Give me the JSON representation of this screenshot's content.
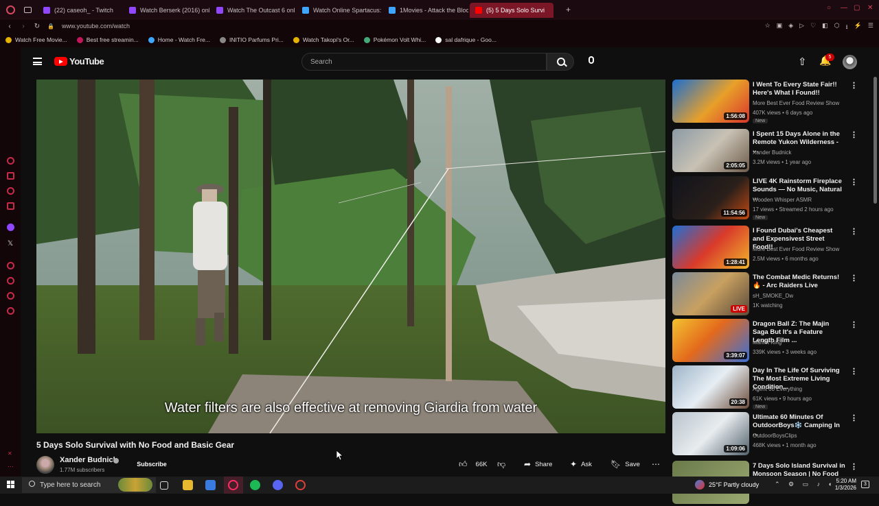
{
  "browser": {
    "tabs": [
      {
        "label": "(22) caseoh_ - Twitch",
        "color": "#9146ff"
      },
      {
        "label": "Watch Berserk (2016) onli",
        "color": "#9146ff"
      },
      {
        "label": "Watch The Outcast 6 onlin",
        "color": "#9146ff"
      },
      {
        "label": "Watch Online Spartacus: I",
        "color": "#3ea6ff"
      },
      {
        "label": "1Movies - Attack the Block",
        "color": "#3ea6ff"
      },
      {
        "label": "(5) 5 Days Solo Survi",
        "color": "#ff0000",
        "active": true
      }
    ],
    "url": "www.youtube.com/watch",
    "bookmarks": [
      {
        "label": "Watch Free Movie...",
        "color": "#e5b200"
      },
      {
        "label": "Best free streamin...",
        "color": "#c2185b"
      },
      {
        "label": "Home - Watch Fre...",
        "color": "#3ea6ff"
      },
      {
        "label": "INITIO Parfums Pri...",
        "color": "#888888"
      },
      {
        "label": "Watch Takopi's Or...",
        "color": "#e5b200"
      },
      {
        "label": "Pokémon Volt Whi...",
        "color": "#4a7"
      },
      {
        "label": "sal dafrique - Goo...",
        "color": "#ffffff"
      }
    ]
  },
  "youtube": {
    "logo": "YouTube",
    "search_placeholder": "Search",
    "notification_count": "5",
    "video": {
      "title": "5 Days Solo Survival with No Food and Basic Gear",
      "subtitle": "Water filters are also effective at removing Giardia from water",
      "channel": "Xander Budnick",
      "subscribers": "1.77M subscribers",
      "subscribe_label": "Subscribe",
      "likes": "66K",
      "share_label": "Share",
      "ask_label": "Ask",
      "save_label": "Save"
    },
    "recommendations": [
      {
        "title": "I Went To Every State Fair!! Here's What I Found!!",
        "channel": "More Best Ever Food Review Show",
        "meta": "407K views • 6 days ago",
        "badge": "New",
        "duration": "1:56:08",
        "thumb": "linear-gradient(135deg,#1b6fd1,#e8a02a 55%,#d8342c)"
      },
      {
        "title": "I Spent 15 Days Alone in the Remote Yukon Wilderness - ...",
        "channel": "Xander Budnick",
        "meta": "3.2M views • 1 year ago",
        "badge": "",
        "duration": "2:05:05",
        "thumb": "linear-gradient(135deg,#8b9aa5,#c8c2b4 50%,#6d5a4a)"
      },
      {
        "title": "LIVE 4K Rainstorm Fireplace Sounds — No Music, Natural ...",
        "channel": "Wooden Whisper ASMR",
        "meta": "17 views • Streamed 2 hours ago",
        "badge": "New",
        "duration": "11:54:56",
        "thumb": "linear-gradient(135deg,#10141c,#2a1f1a 60%,#c44a12)"
      },
      {
        "title": "I Found Dubai's Cheapest and Expensivest Street Food!!",
        "channel": "More Best Ever Food Review Show",
        "meta": "2.5M views • 6 months ago",
        "badge": "",
        "duration": "1:28:41",
        "thumb": "linear-gradient(135deg,#1e6ed6,#d93a2b 50%,#f0b72b)"
      },
      {
        "title": "The Combat Medic Returns! 🔥 - Arc Raiders Live",
        "channel": "sH_SMOKE_Dw",
        "meta": "1K watching",
        "badge": "",
        "duration": "LIVE",
        "live": true,
        "thumb": "linear-gradient(135deg,#7a8a9a,#c8a060 50%,#5a4a3a)"
      },
      {
        "title": "Dragon Ball Z: The Majin Saga But It's a Feature Length Film ...",
        "channel": "Manlet King",
        "meta": "339K views • 3 weeks ago",
        "badge": "",
        "duration": "3:39:07",
        "thumb": "linear-gradient(135deg,#f2c230,#e46a1c 45%,#3a6fd8)"
      },
      {
        "title": "Day In The Life Of Surviving The Most Extreme Living Condition...",
        "channel": "Agent 00 Everything",
        "meta": "61K views • 9 hours ago",
        "badge": "New",
        "duration": "20:38",
        "thumb": "linear-gradient(135deg,#9eb4c8,#e6eef4 50%,#6d4c3a)"
      },
      {
        "title": "Ultimate 60 Minutes Of OutdoorBoys❄️ Camping In ...",
        "channel": "OutdoorBoysClips",
        "meta": "468K views • 1 month ago",
        "badge": "",
        "duration": "1:09:06",
        "thumb": "linear-gradient(135deg,#b8c4cc,#e8ecef 50%,#50606a)"
      },
      {
        "title": "7 Days Solo Island Survival in Monsoon Season | No Food ...",
        "channel": "",
        "meta": "",
        "badge": "",
        "duration": "",
        "thumb": "linear-gradient(135deg,#6a7a4a,#9aa870)"
      }
    ]
  },
  "taskbar": {
    "search_placeholder": "Type here to search",
    "weather": "25°F  Partly cloudy",
    "time": "5:20 AM",
    "date": "1/3/2026",
    "notification_count": "3"
  }
}
